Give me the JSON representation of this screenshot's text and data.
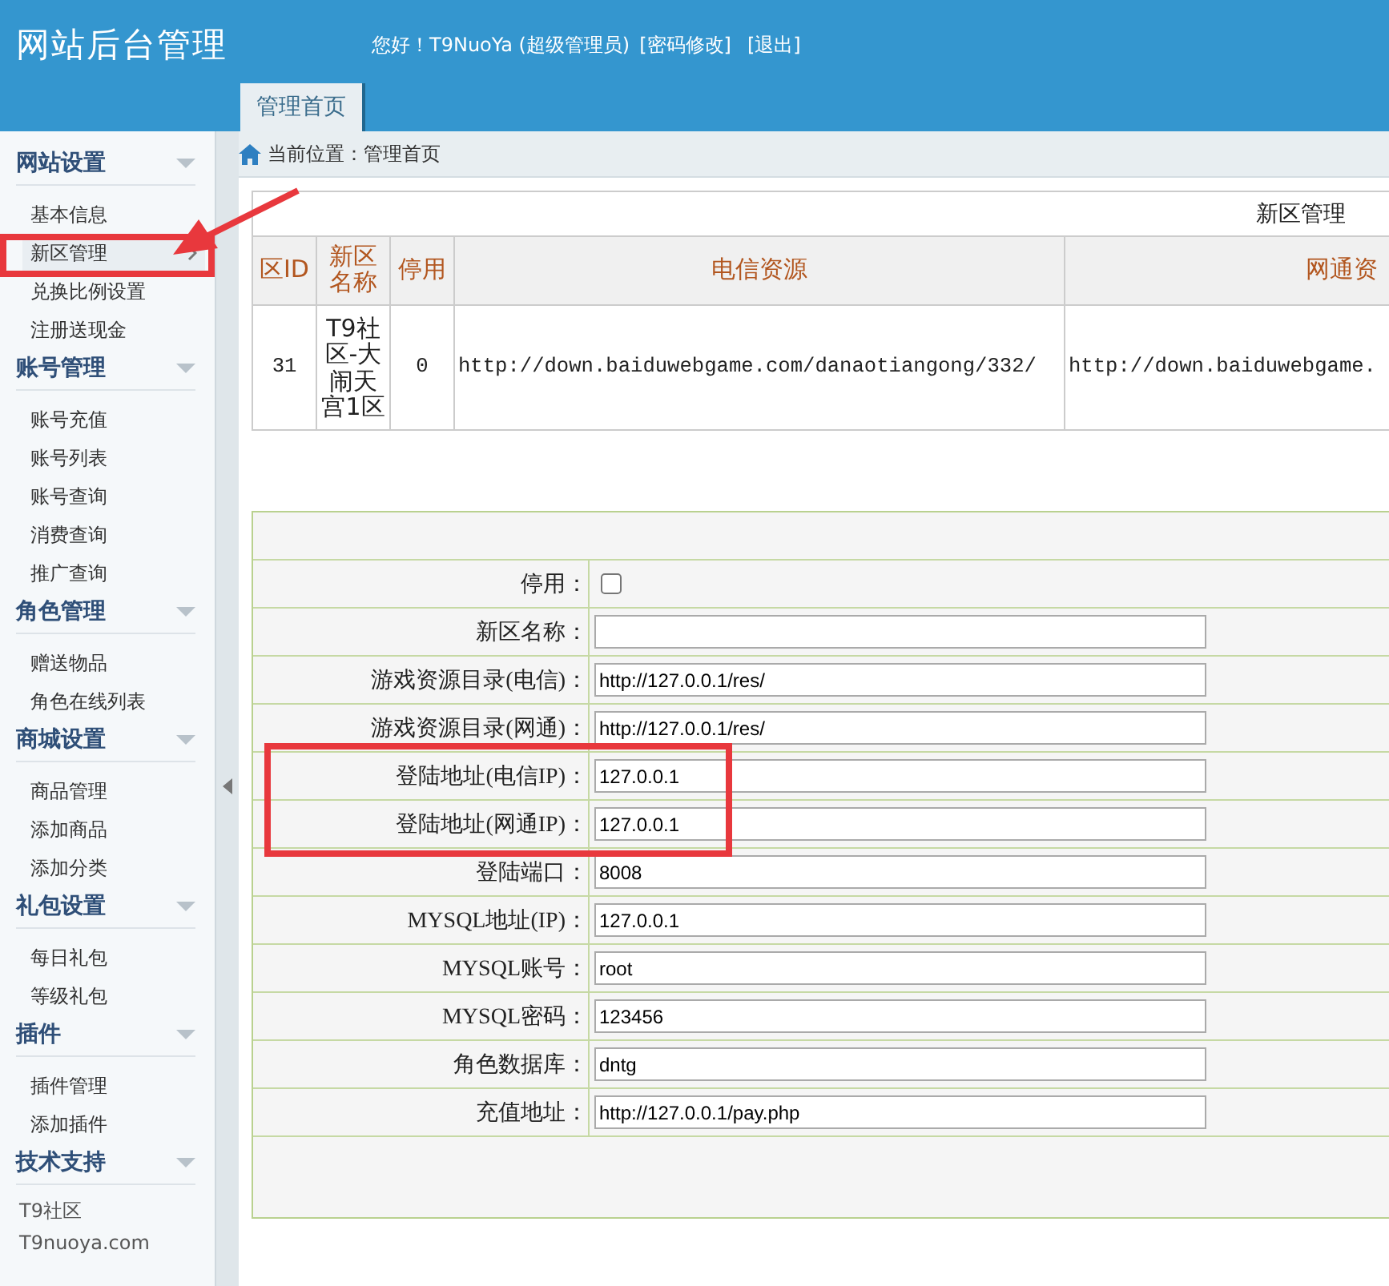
{
  "header": {
    "title": "网站后台管理",
    "greeting": "您好！T9NuoYa (超级管理员)",
    "links": [
      "[密码修改]",
      "[退出]"
    ]
  },
  "tabs": [
    {
      "label": "管理首页",
      "selected": true
    }
  ],
  "breadcrumb": "当前位置：管理首页",
  "sidebar": {
    "groups": [
      {
        "title": "网站设置",
        "expanded": true,
        "items": [
          {
            "label": "基本信息",
            "selected": false
          },
          {
            "label": "新区管理",
            "selected": true
          },
          {
            "label": "兑换比例设置",
            "selected": false
          },
          {
            "label": "注册送现金",
            "selected": false
          }
        ]
      },
      {
        "title": "账号管理",
        "expanded": true,
        "items": [
          {
            "label": "账号充值",
            "selected": false
          },
          {
            "label": "账号列表",
            "selected": false
          },
          {
            "label": "账号查询",
            "selected": false
          },
          {
            "label": "消费查询",
            "selected": false
          },
          {
            "label": "推广查询",
            "selected": false
          }
        ]
      },
      {
        "title": "角色管理",
        "expanded": true,
        "items": [
          {
            "label": "赠送物品",
            "selected": false
          },
          {
            "label": "角色在线列表",
            "selected": false
          }
        ]
      },
      {
        "title": "商城设置",
        "expanded": true,
        "items": [
          {
            "label": "商品管理",
            "selected": false
          },
          {
            "label": "添加商品",
            "selected": false
          },
          {
            "label": "添加分类",
            "selected": false
          }
        ]
      },
      {
        "title": "礼包设置",
        "expanded": true,
        "items": [
          {
            "label": "每日礼包",
            "selected": false
          },
          {
            "label": "等级礼包",
            "selected": false
          }
        ]
      },
      {
        "title": "插件",
        "expanded": true,
        "items": [
          {
            "label": "插件管理",
            "selected": false
          },
          {
            "label": "添加插件",
            "selected": false
          }
        ]
      },
      {
        "title": "技术支持",
        "expanded": true,
        "items": [
          {
            "label": "T9社区",
            "kind": "text"
          },
          {
            "label": "T9nuoya.com",
            "kind": "text"
          }
        ]
      }
    ]
  },
  "table": {
    "caption": "新区管理",
    "columns": [
      "区ID",
      "新区名称",
      "停用",
      "电信资源",
      "网通资"
    ],
    "rows": [
      [
        "31",
        "T9社区-大闹天宫1区",
        "0",
        "http://down.baiduwebgame.com/danaotiangong/332/",
        "http://down.baiduwebgame."
      ]
    ]
  },
  "form": {
    "fields": [
      {
        "label": "停用：",
        "kind": "checkbox",
        "checked": false
      },
      {
        "label": "新区名称：",
        "kind": "text"
      },
      {
        "label": "游戏资源目录(电信)：",
        "kind": "text",
        "value": "http://127.0.0.1/res/"
      },
      {
        "label": "游戏资源目录(网通)：",
        "kind": "text",
        "value": "http://127.0.0.1/res/"
      },
      {
        "label": "登陆地址(电信IP)：",
        "kind": "text",
        "value": "127.0.0.1"
      },
      {
        "label": "登陆地址(网通IP)：",
        "kind": "text",
        "value": "127.0.0.1"
      },
      {
        "label": "登陆端口：",
        "kind": "text",
        "value": "8008"
      },
      {
        "label": "MYSQL地址(IP)：",
        "kind": "text",
        "value": "127.0.0.1"
      },
      {
        "label": "MYSQL账号：",
        "kind": "text",
        "value": "root"
      },
      {
        "label": "MYSQL密码：",
        "kind": "text",
        "value": "123456"
      },
      {
        "label": "角色数据库：",
        "kind": "text",
        "value": "dntg"
      },
      {
        "label": "充值地址：",
        "kind": "text",
        "value": "http://127.0.0.1/pay.php"
      }
    ]
  }
}
